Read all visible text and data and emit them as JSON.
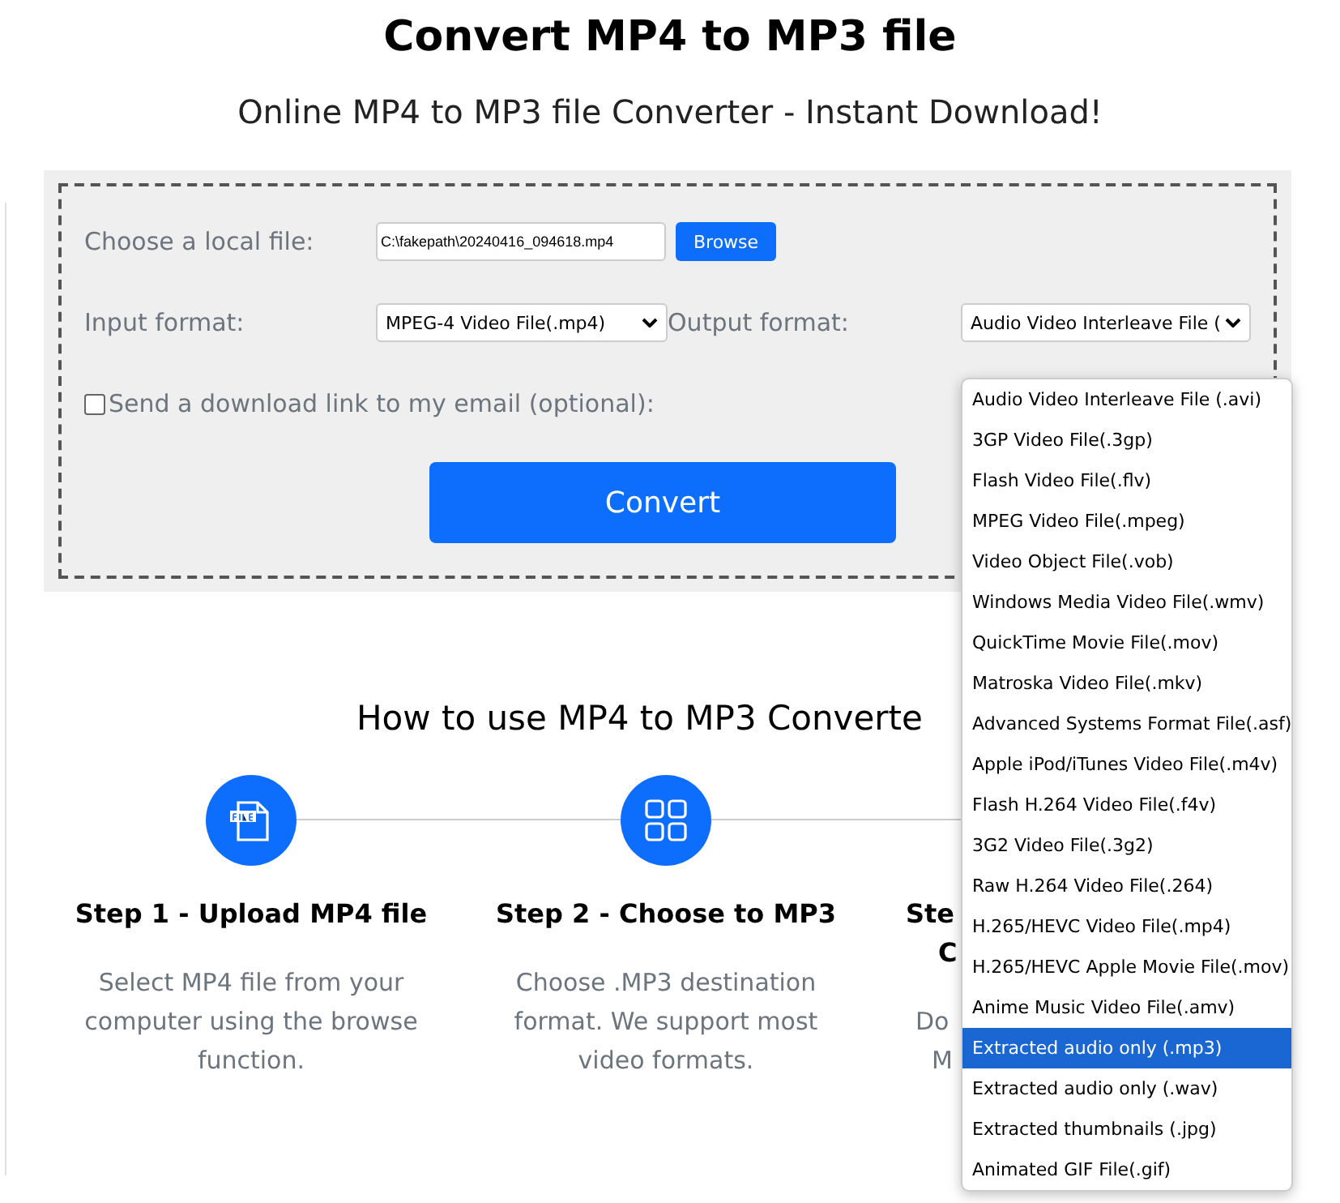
{
  "header": {
    "title": "Convert MP4 to MP3 file",
    "subtitle": "Online MP4 to MP3 file Converter - Instant Download!"
  },
  "form": {
    "file_label": "Choose a local file:",
    "file_value": "C:\\fakepath\\20240416_094618.mp4",
    "browse_button": "Browse",
    "input_label": "Input format:",
    "input_value": "MPEG-4 Video File(.mp4)",
    "output_label": "Output format:",
    "output_value": "Audio Video Interleave File (",
    "email_checkbox": {
      "label": "Send a download link to my email (optional):",
      "checked": false
    },
    "convert_button": "Convert"
  },
  "output_dropdown": {
    "options": [
      {
        "label": "Audio Video Interleave File (.avi)",
        "selected": false
      },
      {
        "label": "3GP Video File(.3gp)",
        "selected": false
      },
      {
        "label": "Flash Video File(.flv)",
        "selected": false
      },
      {
        "label": "MPEG Video File(.mpeg)",
        "selected": false
      },
      {
        "label": "Video Object File(.vob)",
        "selected": false
      },
      {
        "label": "Windows Media Video File(.wmv)",
        "selected": false
      },
      {
        "label": "QuickTime Movie File(.mov)",
        "selected": false
      },
      {
        "label": "Matroska Video File(.mkv)",
        "selected": false
      },
      {
        "label": "Advanced Systems Format File(.asf)",
        "selected": false
      },
      {
        "label": "Apple iPod/iTunes Video File(.m4v)",
        "selected": false
      },
      {
        "label": "Flash H.264 Video File(.f4v)",
        "selected": false
      },
      {
        "label": "3G2 Video File(.3g2)",
        "selected": false
      },
      {
        "label": "Raw H.264 Video File(.264)",
        "selected": false
      },
      {
        "label": "H.265/HEVC Video File(.mp4)",
        "selected": false
      },
      {
        "label": "H.265/HEVC Apple Movie File(.mov)",
        "selected": false
      },
      {
        "label": "Anime Music Video File(.amv)",
        "selected": false
      },
      {
        "label": "Extracted audio only (.mp3)",
        "selected": true
      },
      {
        "label": "Extracted audio only (.wav)",
        "selected": false
      },
      {
        "label": "Extracted thumbnails (.jpg)",
        "selected": false
      },
      {
        "label": "Animated GIF File(.gif)",
        "selected": false
      }
    ]
  },
  "how_to": {
    "heading": "How to use MP4 to MP3 Converte",
    "steps": [
      {
        "title_lines": [
          "Step 1 - Upload MP4 file"
        ],
        "description_lines": [
          "Select MP4 file from your",
          "computer using the browse",
          "function."
        ]
      },
      {
        "title_lines": [
          "Step 2 - Choose to MP3"
        ],
        "description_lines": [
          "Choose .MP3 destination",
          "format. We support most",
          "video formats."
        ]
      },
      {
        "title_lines": [
          "Ste",
          "C"
        ],
        "description_lines": [
          "Do",
          "M"
        ]
      }
    ]
  }
}
